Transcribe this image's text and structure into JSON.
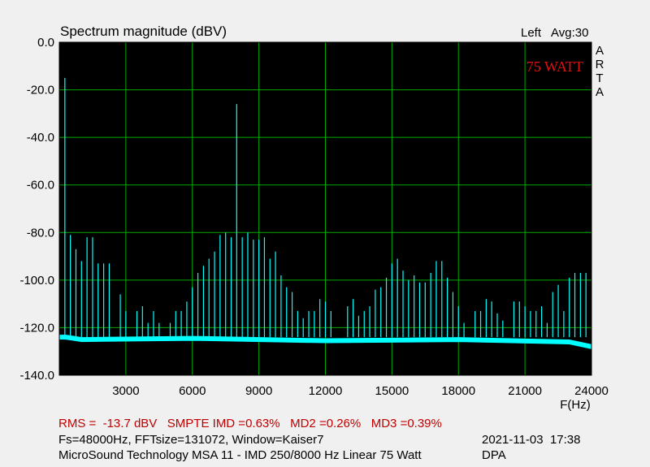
{
  "chart_data": {
    "type": "line",
    "title": "Spectrum magnitude (dBV)",
    "channel_label": "Left",
    "avg_label": "Avg:30",
    "annotation": "75 WATT",
    "side_text": [
      "A",
      "R",
      "T",
      "A"
    ],
    "xlabel": "F(Hz)",
    "ylabel": "",
    "xlim": [
      0,
      24000
    ],
    "ylim": [
      -140,
      0
    ],
    "x_ticks": [
      "3000",
      "6000",
      "9000",
      "12000",
      "15000",
      "18000",
      "21000",
      "24000"
    ],
    "x_tick_values": [
      3000,
      6000,
      9000,
      12000,
      15000,
      18000,
      21000,
      24000
    ],
    "y_ticks": [
      "0.0",
      "-20.0",
      "-40.0",
      "-60.0",
      "-80.0",
      "-100.0",
      "-120.0",
      "-140.0"
    ],
    "y_tick_values": [
      0,
      -20,
      -40,
      -60,
      -80,
      -100,
      -120,
      -140
    ],
    "grid": true,
    "noise_floor": {
      "x": [
        0,
        300,
        1000,
        6000,
        12000,
        18000,
        23000,
        24000
      ],
      "y": [
        -124,
        -124,
        -125,
        -124.5,
        -125.5,
        -125,
        -126,
        -128
      ]
    },
    "series": [
      {
        "values": [
          [
            250,
            -15
          ],
          [
            500,
            -81
          ],
          [
            750,
            -87
          ],
          [
            1000,
            -92
          ],
          [
            1250,
            -82
          ],
          [
            1500,
            -82
          ],
          [
            1750,
            -93
          ],
          [
            2000,
            -93
          ],
          [
            2250,
            -93
          ],
          [
            2750,
            -106
          ],
          [
            3000,
            -113
          ],
          [
            3500,
            -113
          ],
          [
            3750,
            -111
          ],
          [
            4000,
            -118
          ],
          [
            4250,
            -113
          ],
          [
            4500,
            -118
          ],
          [
            5000,
            -118
          ],
          [
            5250,
            -113
          ],
          [
            5500,
            -113
          ],
          [
            5750,
            -109
          ],
          [
            6000,
            -103
          ],
          [
            6250,
            -97
          ],
          [
            6500,
            -94
          ],
          [
            6750,
            -91
          ],
          [
            7000,
            -88
          ],
          [
            7250,
            -81
          ],
          [
            7500,
            -80
          ],
          [
            7750,
            -82
          ],
          [
            8000,
            -26
          ],
          [
            8250,
            -82
          ],
          [
            8500,
            -80
          ],
          [
            8750,
            -83
          ],
          [
            9000,
            -83
          ],
          [
            9250,
            -82
          ],
          [
            9500,
            -91
          ],
          [
            9750,
            -88
          ],
          [
            10000,
            -98
          ],
          [
            10250,
            -103
          ],
          [
            10500,
            -105
          ],
          [
            10750,
            -113
          ],
          [
            11000,
            -116
          ],
          [
            11250,
            -113
          ],
          [
            11500,
            -113
          ],
          [
            11750,
            -108
          ],
          [
            12000,
            -109
          ],
          [
            12250,
            -113
          ],
          [
            13000,
            -111
          ],
          [
            13250,
            -108
          ],
          [
            13500,
            -115
          ],
          [
            13750,
            -113
          ],
          [
            14000,
            -111
          ],
          [
            14250,
            -104
          ],
          [
            14500,
            -103
          ],
          [
            14750,
            -99
          ],
          [
            15000,
            -93
          ],
          [
            15250,
            -91
          ],
          [
            15500,
            -96
          ],
          [
            15750,
            -100
          ],
          [
            16000,
            -98
          ],
          [
            16250,
            -101
          ],
          [
            16500,
            -101
          ],
          [
            16750,
            -97
          ],
          [
            17000,
            -92
          ],
          [
            17250,
            -92
          ],
          [
            17500,
            -99
          ],
          [
            17750,
            -105
          ],
          [
            18000,
            -111
          ],
          [
            18250,
            -118
          ],
          [
            18750,
            -113
          ],
          [
            19000,
            -113
          ],
          [
            19250,
            -108
          ],
          [
            19500,
            -109
          ],
          [
            19750,
            -114
          ],
          [
            20000,
            -117
          ],
          [
            20500,
            -109
          ],
          [
            20750,
            -109
          ],
          [
            21000,
            -111
          ],
          [
            21250,
            -113
          ],
          [
            21500,
            -113
          ],
          [
            21750,
            -111
          ],
          [
            22000,
            -118
          ],
          [
            22250,
            -105
          ],
          [
            22500,
            -102
          ],
          [
            22750,
            -113
          ],
          [
            23000,
            -99
          ],
          [
            23250,
            -97
          ],
          [
            23500,
            -97
          ],
          [
            23750,
            -97
          ]
        ]
      }
    ],
    "trace_color": "#00ffff",
    "grid_color": "#00aa00",
    "plot_background": "#000000"
  },
  "footer": {
    "measurements": "RMS =  -13.7 dBV   SMPTE IMD =0.63%   MD2 =0.26%   MD3 =0.39%",
    "fft_info": "Fs=48000Hz, FFTsize=131072, Window=Kaiser7",
    "datetime": "2021-11-03  17:38",
    "device": "MicroSound Technology MSA 11 - IMD 250/8000 Hz Linear 75 Watt",
    "author": "DPA"
  }
}
